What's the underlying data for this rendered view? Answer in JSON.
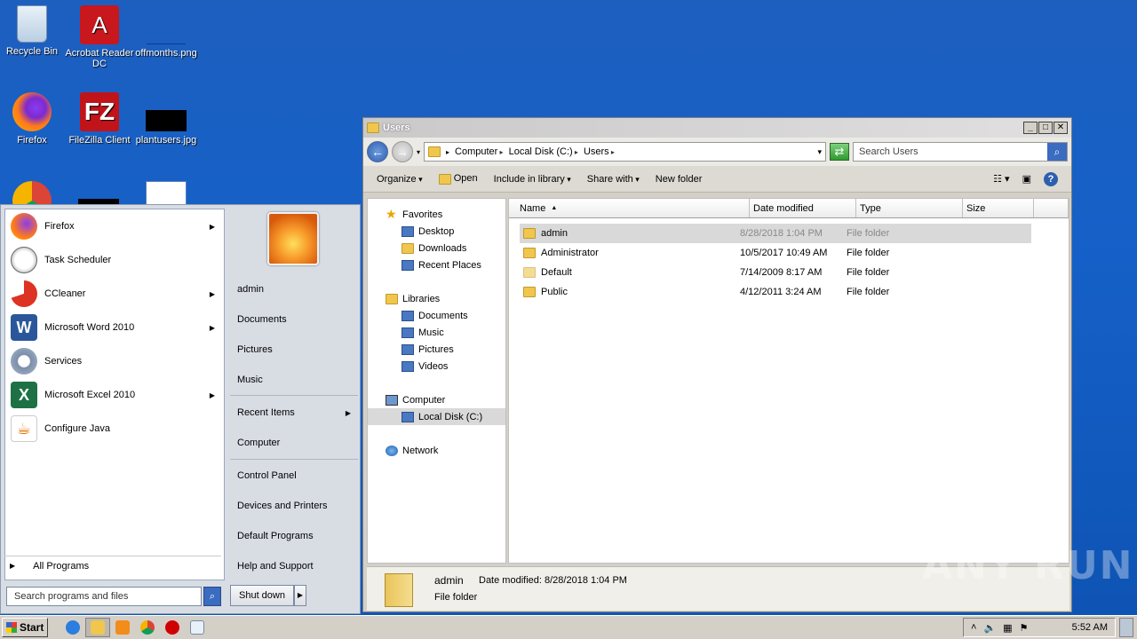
{
  "desktop": {
    "icons": [
      {
        "label": "Recycle Bin",
        "icon": "recycle-bin-icon"
      },
      {
        "label": "Acrobat Reader DC",
        "icon": "acrobat-icon"
      },
      {
        "label": "offmonths.png",
        "icon": "image-file-icon"
      },
      {
        "label": "Firefox",
        "icon": "firefox-icon"
      },
      {
        "label": "FileZilla Client",
        "icon": "filezilla-icon"
      },
      {
        "label": "plantusers.jpg",
        "icon": "image-file-icon"
      }
    ]
  },
  "explorer": {
    "title": "Users",
    "breadcrumb": [
      "Computer",
      "Local Disk (C:)",
      "Users"
    ],
    "search_placeholder": "Search Users",
    "commands": {
      "organize": "Organize",
      "open": "Open",
      "include": "Include in library",
      "share": "Share with",
      "new_folder": "New folder"
    },
    "nav": {
      "favorites": "Favorites",
      "fav_items": [
        "Desktop",
        "Downloads",
        "Recent Places"
      ],
      "libraries": "Libraries",
      "lib_items": [
        "Documents",
        "Music",
        "Pictures",
        "Videos"
      ],
      "computer": "Computer",
      "local_disk": "Local Disk (C:)",
      "network": "Network"
    },
    "columns": {
      "name": "Name",
      "date": "Date modified",
      "type": "Type",
      "size": "Size"
    },
    "files": [
      {
        "name": "admin",
        "date": "8/28/2018 1:04 PM",
        "type": "File folder"
      },
      {
        "name": "Administrator",
        "date": "10/5/2017 10:49 AM",
        "type": "File folder"
      },
      {
        "name": "Default",
        "date": "7/14/2009 8:17 AM",
        "type": "File folder"
      },
      {
        "name": "Public",
        "date": "4/12/2011 3:24 AM",
        "type": "File folder"
      }
    ],
    "details": {
      "name": "admin",
      "date_label": "Date modified:",
      "date": "8/28/2018 1:04 PM",
      "type": "File folder"
    }
  },
  "start_menu": {
    "programs": [
      "Firefox",
      "Task Scheduler",
      "CCleaner",
      "Microsoft Word 2010",
      "Services",
      "Microsoft Excel 2010",
      "Configure Java"
    ],
    "all_programs": "All Programs",
    "search_placeholder": "Search programs and files",
    "right": {
      "user": "admin",
      "documents": "Documents",
      "pictures": "Pictures",
      "music": "Music",
      "recent": "Recent Items",
      "computer": "Computer",
      "control_panel": "Control Panel",
      "devices": "Devices and Printers",
      "default_programs": "Default Programs",
      "help": "Help and Support"
    },
    "shutdown": "Shut down"
  },
  "taskbar": {
    "start": "Start",
    "clock": "5:52 AM"
  },
  "watermark": "ANY RUN"
}
